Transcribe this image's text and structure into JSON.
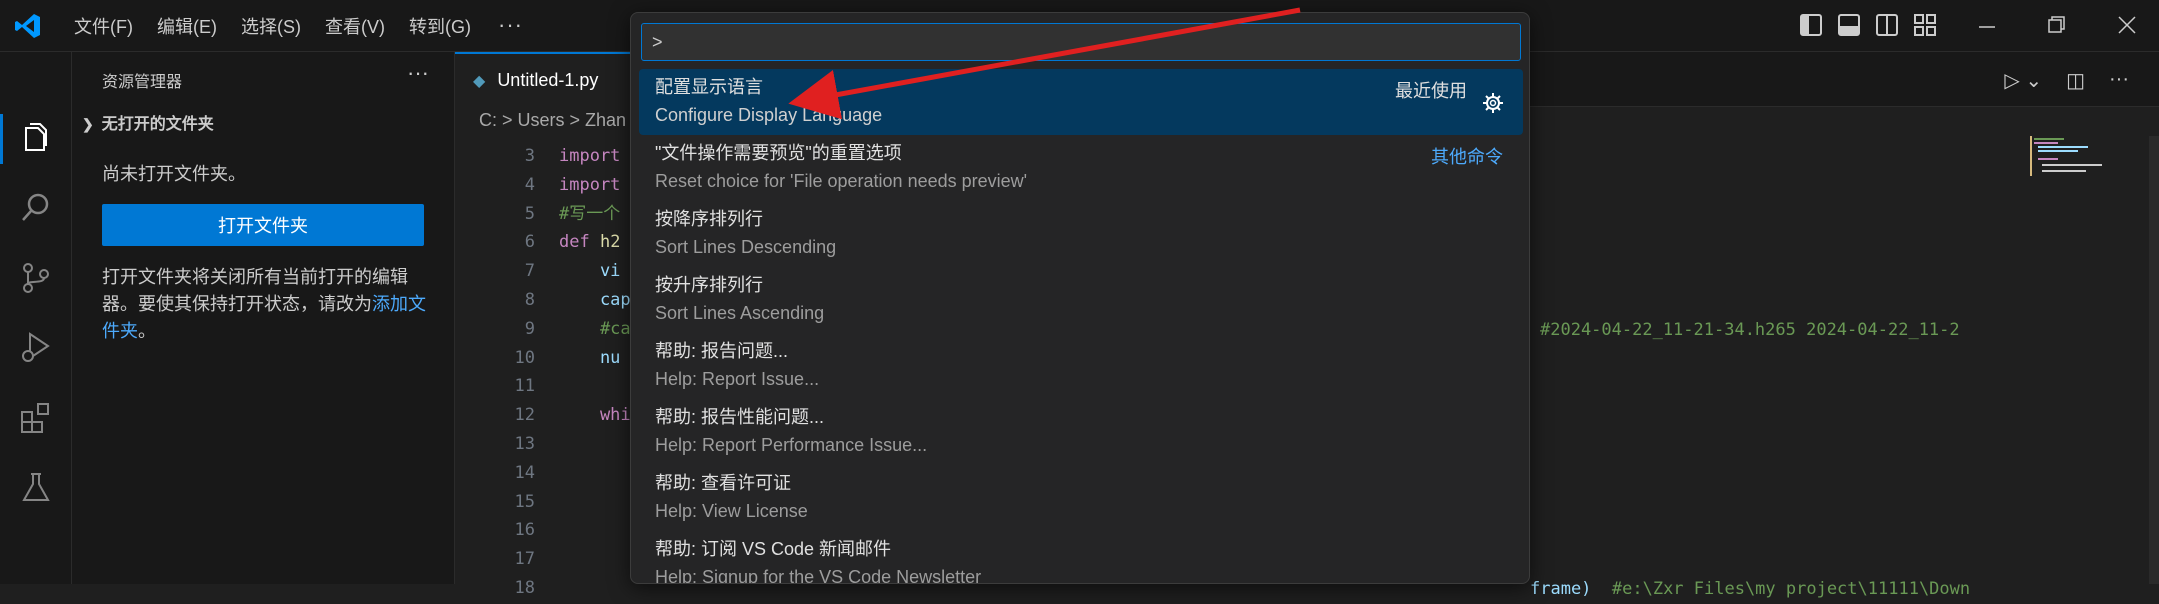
{
  "menu": [
    "文件(F)",
    "编辑(E)",
    "选择(S)",
    "查看(V)",
    "转到(G)"
  ],
  "titlebar": {
    "more": "···"
  },
  "sidebar": {
    "title": "资源管理器",
    "more": "···",
    "section": "无打开的文件夹",
    "no_folder_text": "尚未打开文件夹。",
    "open_button": "打开文件夹",
    "info_text": "打开文件夹将关闭所有当前打开的编辑器。要使其保持打开状态，请改为",
    "info_link": "添加文件夹",
    "info_end": "。"
  },
  "editor": {
    "tab_label": "Untitled-1.py",
    "breadcrumb": "C: > Users > Zhan",
    "line_numbers": [
      "3",
      "4",
      "5",
      "6",
      "7",
      "8",
      "9",
      "10",
      "11",
      "12",
      "13",
      "14",
      "15",
      "16",
      "17",
      "18"
    ],
    "code_lines": [
      {
        "kw": "import",
        "rest": ""
      },
      {
        "kw": "import",
        "rest": ""
      },
      {
        "cm": "#写一个",
        "rest": ""
      },
      {
        "kw": "def",
        "fn": " h2",
        "rest": ""
      },
      {
        "var": "    vi",
        "rest": ""
      },
      {
        "var": "    cap",
        "rest": ""
      },
      {
        "cm": "    #ca",
        "rest": ""
      },
      {
        "var": "    nu",
        "rest": ""
      },
      {
        "rest": ""
      },
      {
        "kw": "    whi",
        "rest": ""
      },
      {
        "rest": ""
      },
      {
        "rest": ""
      },
      {
        "rest": ""
      },
      {
        "rest": ""
      },
      {
        "rest": ""
      },
      {
        "rest": ""
      }
    ],
    "right_line7": "#2024-04-22_11-21-34.h265 2024-04-22_11-2",
    "right_line16_var": "frame)",
    "right_line16_cm": "  #e:\\Zxr Files\\my project\\11111\\Down"
  },
  "palette": {
    "input_value": ">",
    "items": [
      {
        "title": "配置显示语言",
        "subtitle": "Configure Display Language",
        "tag": "最近使用",
        "selected": true
      },
      {
        "title": "\"文件操作需要预览\"的重置选项",
        "subtitle": "Reset choice for 'File operation needs preview'",
        "link": "其他命令"
      },
      {
        "title": "按降序排列行",
        "subtitle": "Sort Lines Descending"
      },
      {
        "title": "按升序排列行",
        "subtitle": "Sort Lines Ascending"
      },
      {
        "title": "帮助: 报告问题...",
        "subtitle": "Help: Report Issue..."
      },
      {
        "title": "帮助: 报告性能问题...",
        "subtitle": "Help: Report Performance Issue..."
      },
      {
        "title": "帮助: 查看许可证",
        "subtitle": "Help: View License"
      },
      {
        "title": "帮助: 订阅 VS Code 新闻邮件",
        "subtitle": "Help: Signup for the VS Code Newsletter"
      }
    ]
  },
  "colors": {
    "accent": "#0078d4",
    "selection": "#04395e",
    "arrow": "#e02020"
  }
}
